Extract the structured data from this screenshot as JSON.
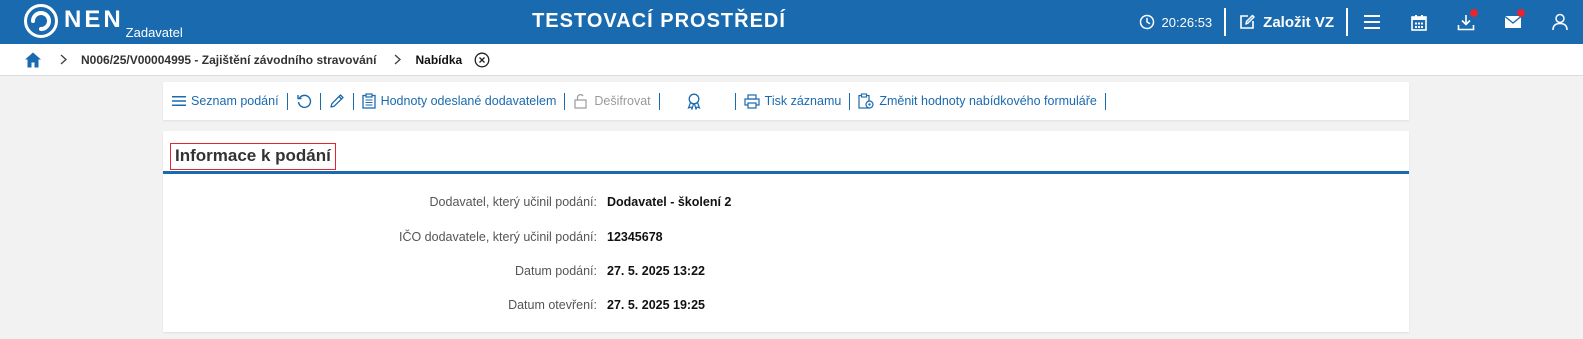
{
  "header": {
    "logo_text": "NEN",
    "logo_sub": "Zadavatel",
    "env_title": "TESTOVACÍ PROSTŘEDÍ",
    "clock": "20:26:53",
    "create_label": "Založit VZ",
    "icons": [
      "clock-icon",
      "edit-icon",
      "menu-icon",
      "calendar-icon",
      "download-icon",
      "mail-icon",
      "user-icon"
    ],
    "accent": "#1a6aaf",
    "notification_color": "#e3262f"
  },
  "breadcrumb": {
    "items": [
      {
        "label": "N006/25/V00004995 - Zajištění závodního stravování"
      },
      {
        "label": "Nabídka"
      }
    ]
  },
  "toolbar": {
    "list_label": "Seznam podání",
    "sent_values_label": "Hodnoty odeslané dodavatelem",
    "decrypt_label": "Dešifrovat",
    "print_label": "Tisk záznamu",
    "change_values_label": "Změnit hodnoty nabídkového formuláře"
  },
  "panel": {
    "title": "Informace k podání",
    "fields": [
      {
        "label": "Dodavatel, který učinil podání:",
        "value": "Dodavatel - školení 2"
      },
      {
        "label": "IČO dodavatele, který učinil podání:",
        "value": "12345678"
      },
      {
        "label": "Datum podání:",
        "value": "27. 5. 2025 13:22"
      },
      {
        "label": "Datum otevření:",
        "value": "27. 5. 2025 19:25"
      }
    ]
  }
}
